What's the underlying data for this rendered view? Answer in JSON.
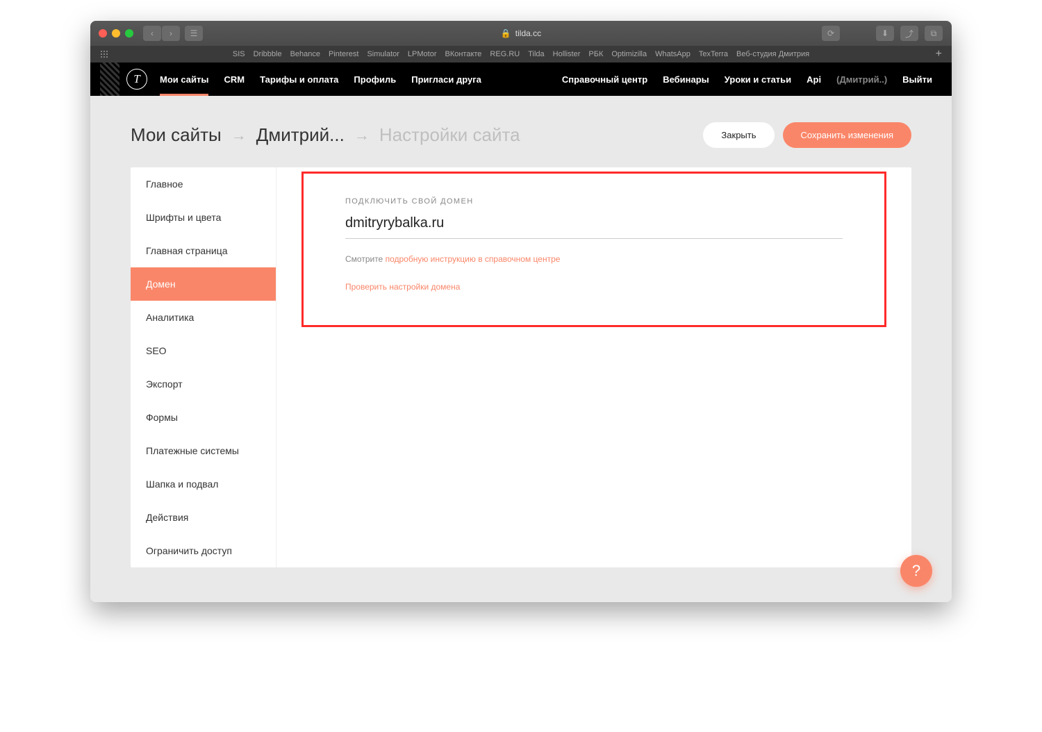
{
  "browser": {
    "url": "tilda.cc",
    "bookmarks": [
      "SIS",
      "Dribbble",
      "Behance",
      "Pinterest",
      "Simulator",
      "LPMotor",
      "ВКонтакте",
      "REG.RU",
      "Tilda",
      "Hollister",
      "РБК",
      "Optimizilla",
      "WhatsApp",
      "TexTerra",
      "Веб-студия Дмитрия"
    ]
  },
  "topnav": {
    "left": [
      "Мои сайты",
      "CRM",
      "Тарифы и оплата",
      "Профиль",
      "Пригласи друга"
    ],
    "right": [
      "Справочный центр",
      "Вебинары",
      "Уроки и статьи",
      "Api"
    ],
    "user": "(Дмитрий..)",
    "logout": "Выйти",
    "active_index": 0
  },
  "breadcrumb": {
    "a": "Мои сайты",
    "b": "Дмитрий...",
    "c": "Настройки сайта",
    "close": "Закрыть",
    "save": "Сохранить изменения"
  },
  "sidebar": {
    "items": [
      "Главное",
      "Шрифты и цвета",
      "Главная страница",
      "Домен",
      "Аналитика",
      "SEO",
      "Экспорт",
      "Формы",
      "Платежные системы",
      "Шапка и подвал",
      "Действия",
      "Ограничить доступ"
    ],
    "active_index": 3
  },
  "domain": {
    "label": "ПОДКЛЮЧИТЬ СВОЙ ДОМЕН",
    "value": "dmitryrybalka.ru",
    "hint_prefix": "Смотрите ",
    "hint_link": "подробную инструкцию в справочном центре",
    "check_link": "Проверить настройки домена"
  },
  "help": "?"
}
